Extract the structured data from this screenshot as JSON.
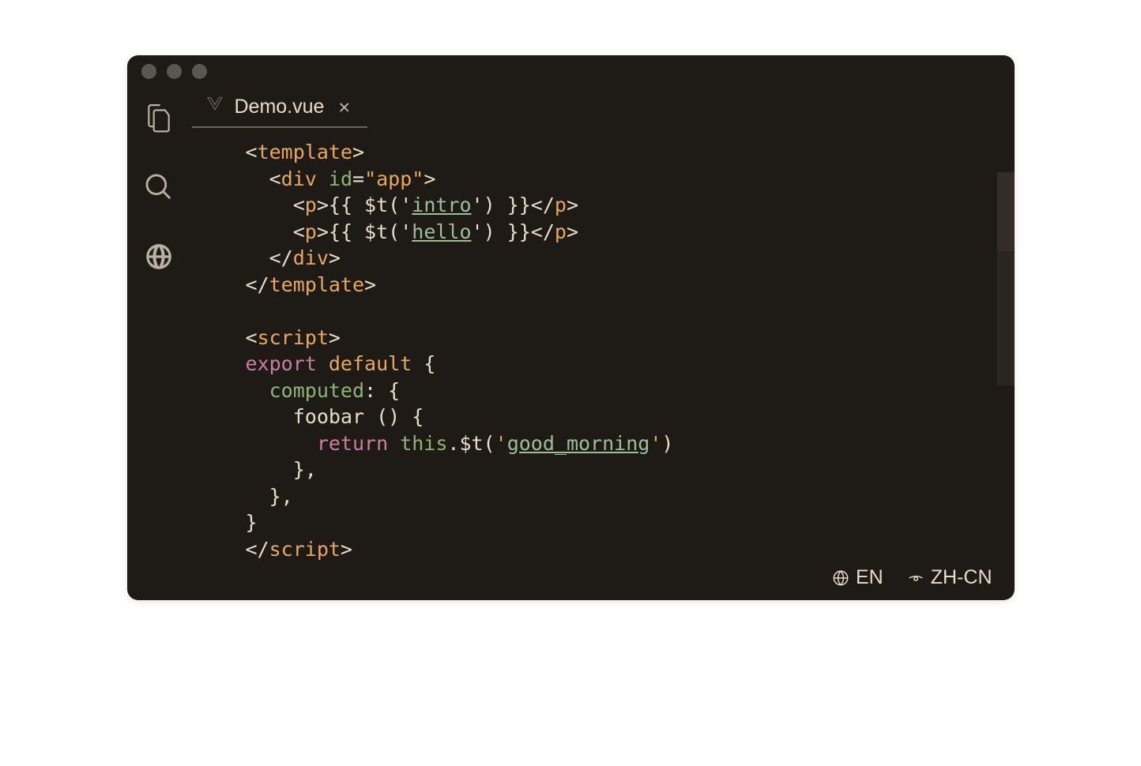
{
  "tab": {
    "filename": "Demo.vue"
  },
  "statusbar": {
    "lang1": "EN",
    "lang2": "ZH-CN"
  },
  "code": {
    "line1": {
      "tag": "template"
    },
    "line2": {
      "tag": "div",
      "attr": "id",
      "val": "\"app\""
    },
    "line3": {
      "tag": "p",
      "expr1": "{{ $t('",
      "key": "intro",
      "expr2": "') }}"
    },
    "line4": {
      "tag": "p",
      "expr1": "{{ $t('",
      "key": "hello",
      "expr2": "') }}"
    },
    "line5": {
      "tag": "div"
    },
    "line6": {
      "tag": "template"
    },
    "line8": {
      "tag": "script"
    },
    "line9": {
      "export": "export",
      "default": "default",
      "brace": " {"
    },
    "line10": {
      "prop": "computed",
      "rest": ": {"
    },
    "line11": {
      "fn": "foobar",
      "rest": " () {"
    },
    "line12": {
      "ret": "return",
      "this": "this",
      "method": ".$t(",
      "q1": "'",
      "key": "good_morning",
      "q2": "'",
      "close": ")"
    },
    "line13": {
      "txt": "},"
    },
    "line14": {
      "txt": "},"
    },
    "line15": {
      "txt": "}"
    },
    "line16": {
      "tag": "script"
    }
  }
}
